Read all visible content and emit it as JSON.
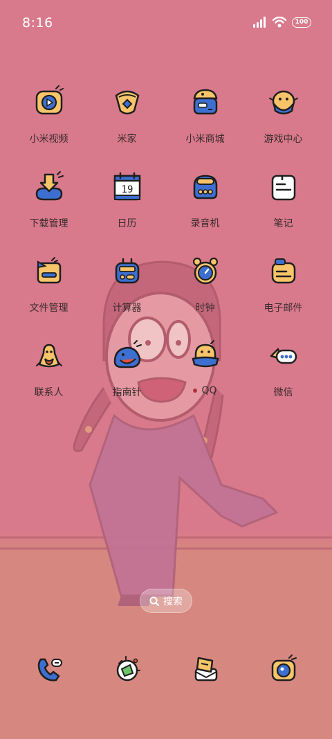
{
  "status_bar": {
    "time": "8:16",
    "battery": "100"
  },
  "apps": [
    {
      "label": "小米视频",
      "icon": "video-icon"
    },
    {
      "label": "米家",
      "icon": "mijia-icon"
    },
    {
      "label": "小米商城",
      "icon": "store-icon"
    },
    {
      "label": "游戏中心",
      "icon": "game-center-icon"
    },
    {
      "label": "下载管理",
      "icon": "download-icon"
    },
    {
      "label": "日历",
      "icon": "calendar-icon",
      "day": "19"
    },
    {
      "label": "录音机",
      "icon": "recorder-icon"
    },
    {
      "label": "笔记",
      "icon": "notes-icon"
    },
    {
      "label": "文件管理",
      "icon": "file-manager-icon"
    },
    {
      "label": "计算器",
      "icon": "calculator-icon"
    },
    {
      "label": "时钟",
      "icon": "clock-icon"
    },
    {
      "label": "电子邮件",
      "icon": "email-icon"
    },
    {
      "label": "联系人",
      "icon": "contacts-icon"
    },
    {
      "label": "指南针",
      "icon": "compass-icon"
    },
    {
      "label": "QQ",
      "icon": "qq-icon",
      "has_dot": true
    },
    {
      "label": "微信",
      "icon": "wechat-icon"
    }
  ],
  "search": {
    "label": "搜索"
  },
  "dock": [
    {
      "icon": "phone-icon"
    },
    {
      "icon": "browser-icon"
    },
    {
      "icon": "messages-icon"
    },
    {
      "icon": "camera-icon"
    }
  ],
  "colors": {
    "wallpaper_pink": "#d87a8b",
    "icon_yellow": "#f7c46a",
    "icon_blue": "#3d6fd0",
    "icon_outline": "#1e1e1e"
  }
}
